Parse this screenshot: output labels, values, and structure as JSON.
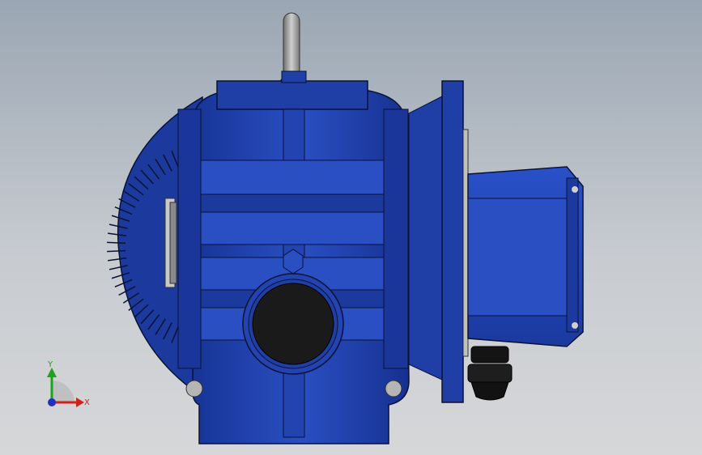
{
  "viewport": {
    "background_top": "#9aa6b3",
    "background_bottom": "#d6d7d9"
  },
  "model": {
    "body_color": "#1f3fa6",
    "body_dark": "#0f2470",
    "body_light": "#3a5fd0",
    "edge_color": "#0a1233",
    "port_color": "#1a1a1a",
    "handle_color": "#9a9a9a",
    "gland_color": "#141414"
  },
  "triad": {
    "x_label": "X",
    "y_label": "Y",
    "x_color": "#d02020",
    "y_color": "#20a020",
    "z_color": "#2030c0"
  }
}
